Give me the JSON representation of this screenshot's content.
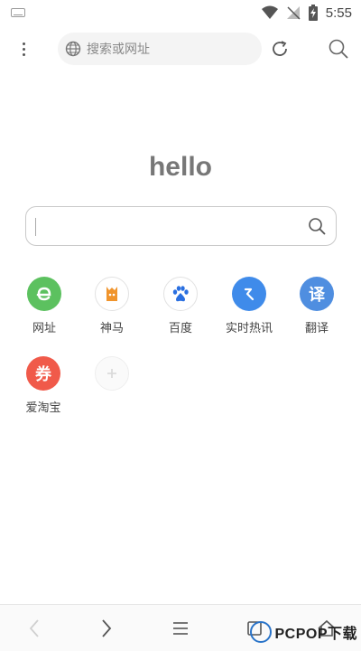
{
  "status_bar": {
    "time": "5:55"
  },
  "top_bar": {
    "url_placeholder": "搜索或网址"
  },
  "home": {
    "greeting": "hello"
  },
  "shortcuts": [
    {
      "label": "网址",
      "icon": "e",
      "color": "#5cc15f"
    },
    {
      "label": "神马",
      "icon": "shenma-icon",
      "color": "#ffffff"
    },
    {
      "label": "百度",
      "icon": "baidu-paw-icon",
      "color": "#ffffff"
    },
    {
      "label": "实时热讯",
      "icon": "arrow-icon",
      "color": "#3f8bea"
    },
    {
      "label": "翻译",
      "icon": "译",
      "color": "#4f8ee0"
    },
    {
      "label": "爱淘宝",
      "icon": "券",
      "color": "#f05a4a"
    }
  ],
  "watermark": {
    "text": "PCPOP下载"
  },
  "colors": {
    "accent_blue": "#3f8bea",
    "background": "#ffffff"
  }
}
